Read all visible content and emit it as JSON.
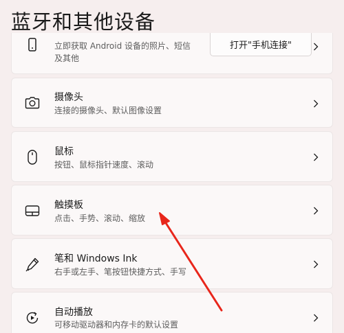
{
  "page": {
    "title": "蓝牙和其他设备"
  },
  "items": [
    {
      "icon": "phone-icon",
      "subtitle_line1": "立即获取 Android 设备的照片、短信",
      "subtitle_line2": "及其他",
      "button_label": "打开\"手机连接\""
    },
    {
      "icon": "camera-icon",
      "title": "摄像头",
      "subtitle": "连接的摄像头、默认图像设置"
    },
    {
      "icon": "mouse-icon",
      "title": "鼠标",
      "subtitle": "按钮、鼠标指针速度、滚动"
    },
    {
      "icon": "touchpad-icon",
      "title": "触摸板",
      "subtitle": "点击、手势、滚动、缩放"
    },
    {
      "icon": "pen-icon",
      "title": "笔和 Windows Ink",
      "subtitle": "右手或左手、笔按钮快捷方式、手写"
    },
    {
      "icon": "autoplay-icon",
      "title": "自动播放",
      "subtitle": "可移动驱动器和内存卡的默认设置"
    }
  ],
  "colors": {
    "background": "#f6eeee",
    "card": "#fbf8f8",
    "annotation_arrow": "#e8261b"
  }
}
